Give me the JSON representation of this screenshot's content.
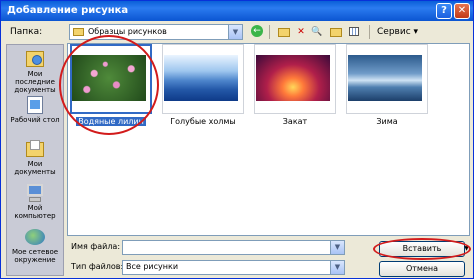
{
  "window": {
    "title": "Добавление рисунка"
  },
  "titlebar": {
    "help_glyph": "?",
    "close_glyph": "✕"
  },
  "folder": {
    "label": "Папка:",
    "value": "Образцы рисунков"
  },
  "toolbar": {
    "back_glyph": "←",
    "delete_glyph": "✕",
    "search_glyph": "🔍",
    "service_label": "Сервис ▾"
  },
  "places": [
    {
      "label": "Мои последние документы"
    },
    {
      "label": "Рабочий стол"
    },
    {
      "label": "Мои документы"
    },
    {
      "label": "Мой компьютер"
    },
    {
      "label": "Мое сетевое окружение"
    }
  ],
  "files": [
    {
      "name": "Водяные лилии",
      "selected": true
    },
    {
      "name": "Голубые холмы",
      "selected": false
    },
    {
      "name": "Закат",
      "selected": false
    },
    {
      "name": "Зима",
      "selected": false
    }
  ],
  "footer": {
    "filename_label": "Имя файла:",
    "filename_value": "",
    "filetype_label": "Тип файлов:",
    "filetype_value": "Все рисунки",
    "insert_label": "Вставить",
    "cancel_label": "Отмена"
  },
  "colors": {
    "titlebar": "#0a5fd8",
    "highlight_oval": "#d21b1b",
    "selection": "#316ac5"
  }
}
